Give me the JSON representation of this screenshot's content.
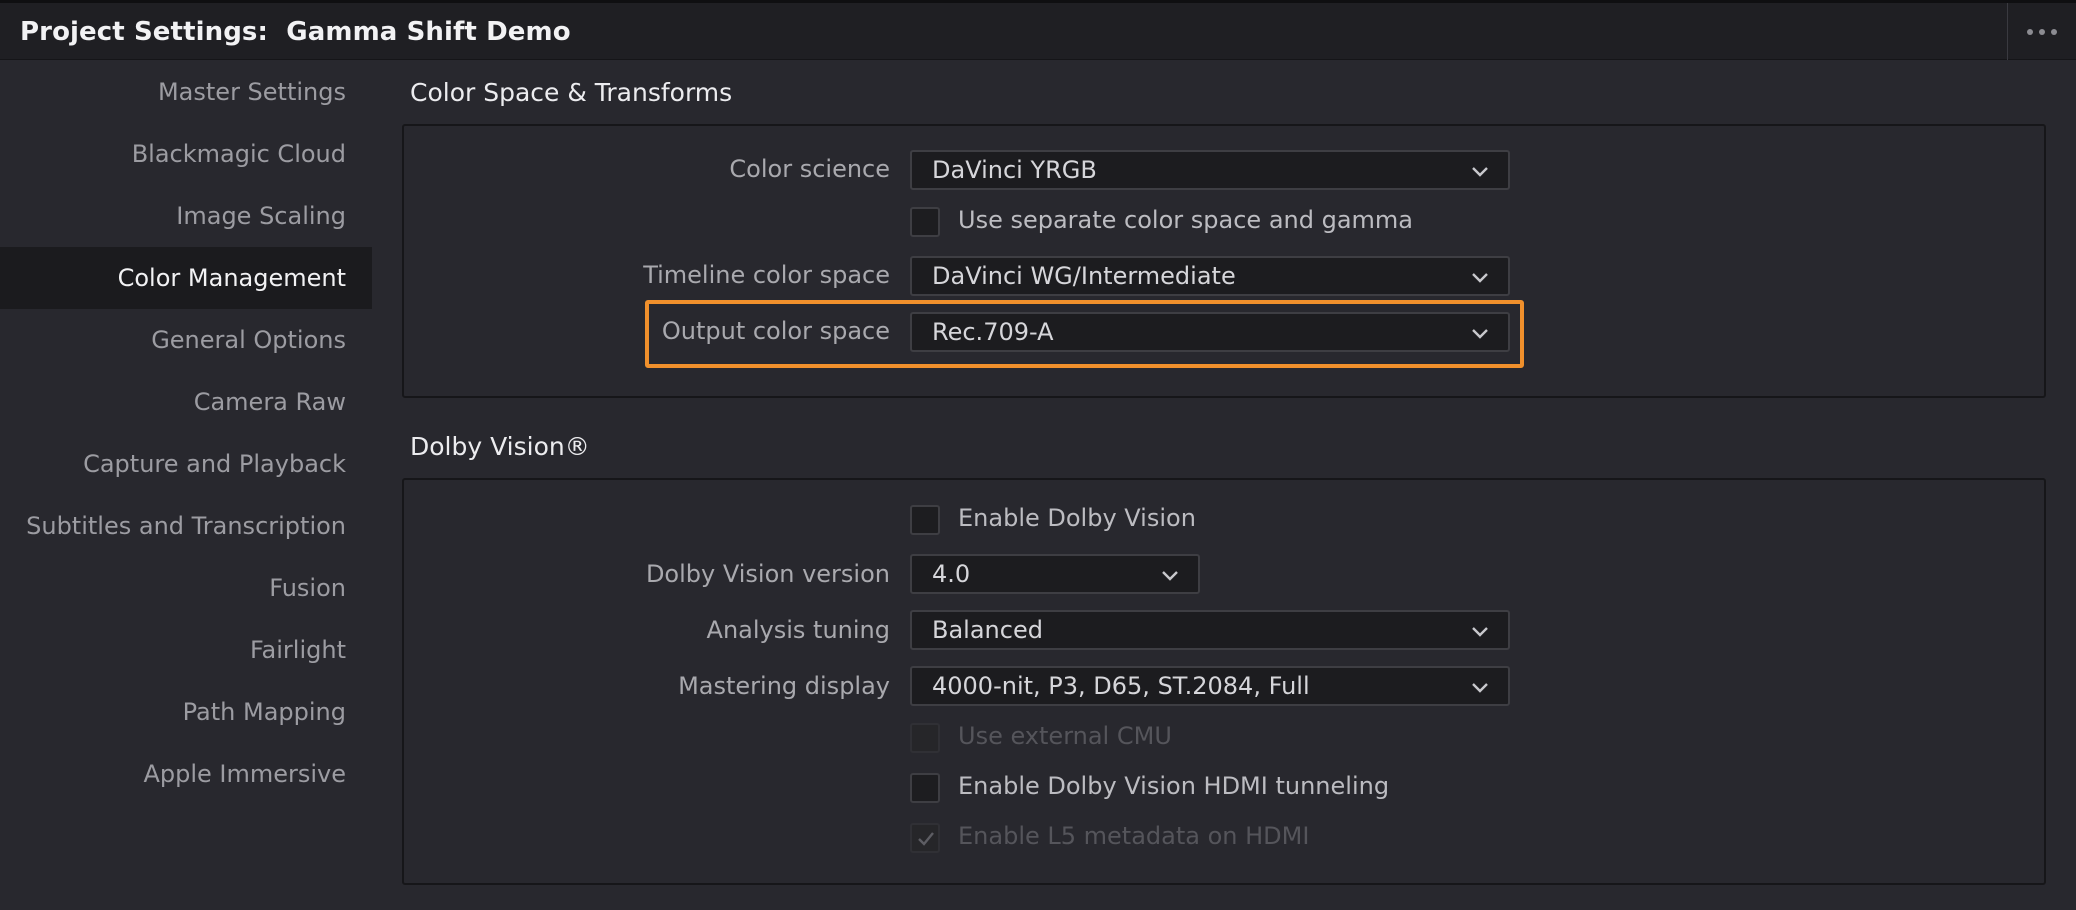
{
  "window": {
    "title": "Project Settings:  Gamma Shift Demo",
    "more_icon": "more-horizontal-icon"
  },
  "sidebar": {
    "items": [
      {
        "label": "Master Settings",
        "active": false
      },
      {
        "label": "Blackmagic Cloud",
        "active": false
      },
      {
        "label": "Image Scaling",
        "active": false
      },
      {
        "label": "Color Management",
        "active": true
      },
      {
        "label": "General Options",
        "active": false
      },
      {
        "label": "Camera Raw",
        "active": false
      },
      {
        "label": "Capture and Playback",
        "active": false
      },
      {
        "label": "Subtitles and Transcription",
        "active": false
      },
      {
        "label": "Fusion",
        "active": false
      },
      {
        "label": "Fairlight",
        "active": false
      },
      {
        "label": "Path Mapping",
        "active": false
      },
      {
        "label": "Apple Immersive",
        "active": false
      }
    ]
  },
  "color_space": {
    "section_title": "Color Space & Transforms",
    "color_science_label": "Color science",
    "color_science_value": "DaVinci YRGB",
    "separate_checkbox_label": "Use separate color space and gamma",
    "separate_checked": false,
    "timeline_label": "Timeline color space",
    "timeline_value": "DaVinci WG/Intermediate",
    "output_label": "Output color space",
    "output_value": "Rec.709-A",
    "highlight_color": "#f0902c"
  },
  "dolby": {
    "section_title": "Dolby Vision®",
    "enable_label": "Enable Dolby Vision",
    "enable_checked": false,
    "version_label": "Dolby Vision version",
    "version_value": "4.0",
    "analysis_label": "Analysis tuning",
    "analysis_value": "Balanced",
    "mastering_label": "Mastering display",
    "mastering_value": "4000-nit, P3, D65, ST.2084, Full",
    "external_cmu_label": "Use external CMU",
    "external_cmu_checked": false,
    "external_cmu_disabled": true,
    "hdmi_tunneling_label": "Enable Dolby Vision HDMI tunneling",
    "hdmi_tunneling_checked": false,
    "l5_label": "Enable L5 metadata on HDMI",
    "l5_checked": true,
    "l5_disabled": true
  }
}
